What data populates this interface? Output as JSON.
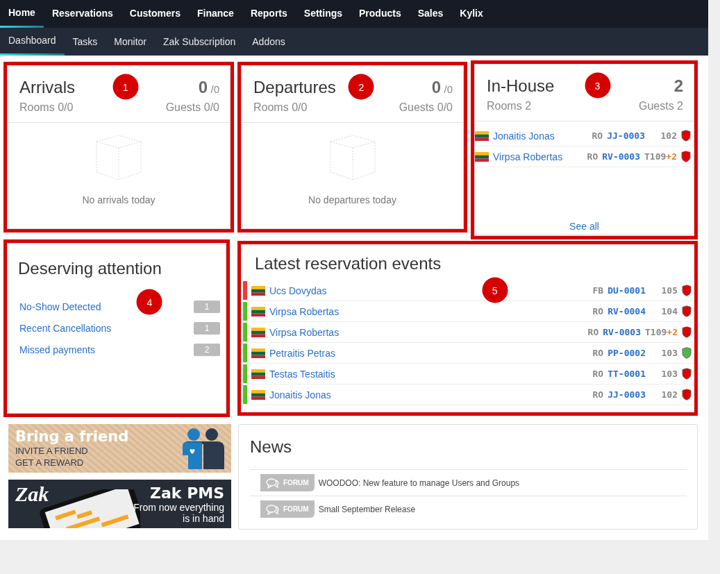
{
  "top_nav": [
    {
      "label": "Home",
      "selected": true
    },
    {
      "label": "Reservations",
      "selected": false
    },
    {
      "label": "Customers",
      "selected": false
    },
    {
      "label": "Finance",
      "selected": false
    },
    {
      "label": "Reports",
      "selected": false
    },
    {
      "label": "Settings",
      "selected": false
    },
    {
      "label": "Products",
      "selected": false
    },
    {
      "label": "Sales",
      "selected": false
    },
    {
      "label": "Kylix",
      "selected": false
    }
  ],
  "sub_nav": [
    {
      "label": "Dashboard",
      "selected": true
    },
    {
      "label": "Tasks",
      "selected": false
    },
    {
      "label": "Monitor",
      "selected": false
    },
    {
      "label": "Zak Subscription",
      "selected": false
    },
    {
      "label": "Addons",
      "selected": false
    }
  ],
  "arrivals": {
    "callout": "1",
    "title": "Arrivals",
    "count": "0",
    "total": "/0",
    "rooms": "Rooms 0/0",
    "guests": "Guests 0/0",
    "empty_text": "No arrivals today"
  },
  "departures": {
    "callout": "2",
    "title": "Departures",
    "count": "0",
    "total": "/0",
    "rooms": "Rooms 0/0",
    "guests": "Guests 0/0",
    "empty_text": "No departures today"
  },
  "in_house": {
    "callout": "3",
    "title": "In-House",
    "count": "2",
    "rooms": "Rooms 2",
    "guests": "Guests 2",
    "see_all": "See all",
    "rows": [
      {
        "name": "Jonaitis Jonas",
        "board": "RO",
        "code": "JJ-0003",
        "room": "102",
        "shield": {
          "color": "#e00000"
        }
      },
      {
        "name": "Virpsa Robertas",
        "board": "RO",
        "code": "RV-0003",
        "room": "T109",
        "extra": "+2",
        "shield": {
          "color": "#e00000"
        }
      }
    ]
  },
  "attention": {
    "callout": "4",
    "title": "Deserving attention",
    "items": [
      {
        "label": "No-Show Detected",
        "count": "1"
      },
      {
        "label": "Recent Cancellations",
        "count": "1"
      },
      {
        "label": "Missed payments",
        "count": "2"
      }
    ]
  },
  "events": {
    "callout": "5",
    "title": "Latest reservation events",
    "rows": [
      {
        "color": "#f03a3a",
        "name": "Ucs Dovydas",
        "board": "FB",
        "code": "DU-0001",
        "room": "105",
        "shield": {
          "color": "#e00000"
        }
      },
      {
        "color": "#52c41a",
        "name": "Virpsa Robertas",
        "board": "RO",
        "code": "RV-0004",
        "room": "104",
        "shield": {
          "color": "#e00000"
        }
      },
      {
        "color": "#52c41a",
        "name": "Virpsa Robertas",
        "board": "RO",
        "code": "RV-0003",
        "room": "T109",
        "extra": "+2",
        "shield": {
          "color": "#e00000"
        }
      },
      {
        "color": "#52c41a",
        "name": "Petraitis Petras",
        "board": "RO",
        "code": "PP-0002",
        "room": "103",
        "shield": {
          "color": "#4cb944"
        }
      },
      {
        "color": "#52c41a",
        "name": "Testas Testaitis",
        "board": "RO",
        "code": "TT-0001",
        "room": "103",
        "shield": {
          "color": "#e00000"
        }
      },
      {
        "color": "#52c41a",
        "name": "Jonaitis Jonas",
        "board": "RO",
        "code": "JJ-0003",
        "room": "102",
        "shield": {
          "color": "#e00000"
        }
      }
    ]
  },
  "banners": [
    {
      "kind": "referral",
      "title": "Bring a friend",
      "lines": [
        "INVITE A FRIEND",
        "GET A REWARD"
      ]
    },
    {
      "kind": "app",
      "logo": "Zak",
      "title": "Zak PMS",
      "lines": [
        "From now everything",
        "is in hand"
      ]
    }
  ],
  "news": {
    "title": "News",
    "items": [
      {
        "tag": "FORUM",
        "text": "WOODOO: New feature to manage Users and Groups"
      },
      {
        "tag": "FORUM",
        "text": "Small September Release"
      }
    ]
  }
}
